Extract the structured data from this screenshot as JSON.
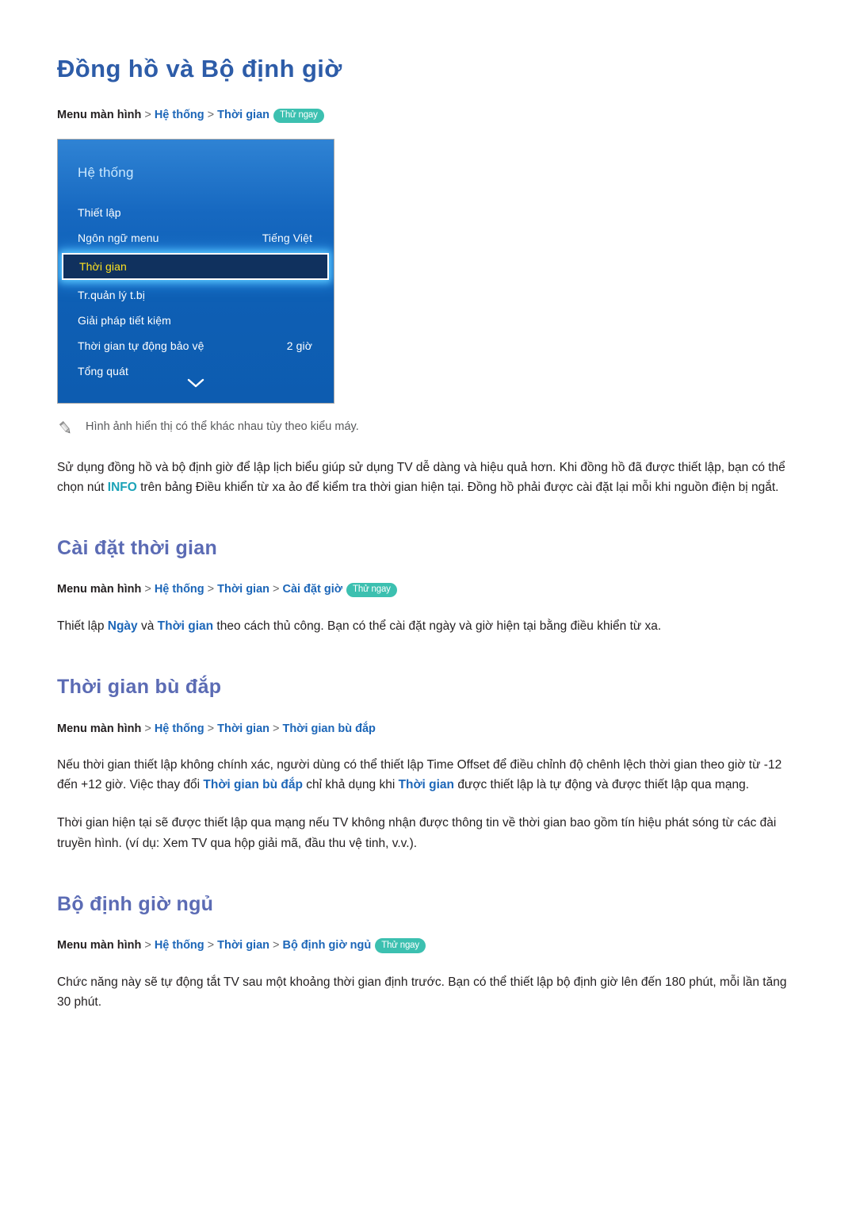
{
  "page": {
    "title": "Đồng hồ và Bộ định giờ"
  },
  "breadcrumbs": {
    "root_label": "Menu màn hình",
    "separator": ">",
    "badge_label": "Thử ngay",
    "clock": {
      "links": [
        "Hệ thống",
        "Thời gian"
      ],
      "has_badge": true
    },
    "time_setup": {
      "links": [
        "Hệ thống",
        "Thời gian",
        "Cài đặt giờ"
      ],
      "has_badge": true
    },
    "time_offset": {
      "links": [
        "Hệ thống",
        "Thời gian",
        "Thời gian bù đắp"
      ],
      "has_badge": false
    },
    "sleep_timer": {
      "links": [
        "Hệ thống",
        "Thời gian",
        "Bộ định giờ ngủ"
      ],
      "has_badge": true
    }
  },
  "tv_menu": {
    "header": "Hệ thống",
    "rows": [
      {
        "label": "Thiết lập",
        "value": "",
        "selected": false
      },
      {
        "label": "Ngôn ngữ menu",
        "value": "Tiếng Việt",
        "selected": false
      },
      {
        "label": "Thời gian",
        "value": "",
        "selected": true
      },
      {
        "label": "Tr.quản lý t.bị",
        "value": "",
        "selected": false
      },
      {
        "label": "Giải pháp tiết kiệm",
        "value": "",
        "selected": false
      },
      {
        "label": "Thời gian tự động bảo vệ",
        "value": "2 giờ",
        "selected": false
      },
      {
        "label": "Tổng quát",
        "value": "",
        "selected": false
      }
    ],
    "scroll_icon": "chevron-down-icon"
  },
  "note": {
    "icon": "pencil-icon",
    "text": "Hình ảnh hiển thị có thể khác nhau tùy theo kiểu máy."
  },
  "intro_paragraph": {
    "part1": "Sử dụng đồng hồ và bộ định giờ để lập lịch biểu giúp sử dụng TV dễ dàng và hiệu quả hơn. Khi đồng hồ đã được thiết lập, bạn có thể chọn nút ",
    "keyword_info": "INFO",
    "part2": " trên bảng Điều khiển từ xa ảo để kiểm tra thời gian hiện tại. Đồng hồ phải được cài đặt lại mỗi khi nguồn điện bị ngắt."
  },
  "sections": {
    "time_setup": {
      "heading": "Cài đặt thời gian",
      "paragraph": {
        "part1": "Thiết lập ",
        "kw1": "Ngày",
        "part2": " và ",
        "kw2": "Thời gian",
        "part3": " theo cách thủ công. Bạn có thể cài đặt ngày và giờ hiện tại bằng điều khiển từ xa."
      }
    },
    "time_offset": {
      "heading": "Thời gian bù đắp",
      "paragraph1": {
        "part1": "Nếu thời gian thiết lập không chính xác, người dùng có thể thiết lập Time Offset để điều chỉnh độ chênh lệch thời gian theo giờ từ -12 đến +12 giờ. Việc thay đổi ",
        "kw1": "Thời gian bù đắp",
        "part2": " chỉ khả dụng khi ",
        "kw2": "Thời gian",
        "part3": " được thiết lập là tự động và được thiết lập qua mạng."
      },
      "paragraph2": "Thời gian hiện tại sẽ được thiết lập qua mạng nếu TV không nhận được thông tin về thời gian bao gồm tín hiệu phát sóng từ các đài truyền hình. (ví dụ: Xem TV qua hộp giải mã, đầu thu vệ tinh, v.v.)."
    },
    "sleep_timer": {
      "heading": "Bộ định giờ ngủ",
      "paragraph": "Chức năng này sẽ tự động tắt TV sau một khoảng thời gian định trước. Bạn có thể thiết lập bộ định giờ lên đến 180 phút, mỗi lần tăng 30 phút."
    }
  },
  "colors": {
    "page_title": "#2d5ca8",
    "section_title": "#5b6bb4",
    "crumb_link": "#1c66b8",
    "badge_bg": "#3cc0b0",
    "keyword_teal": "#1ba3b8",
    "panel_blue": "#1668c0",
    "selected_text": "#ffe21f"
  }
}
